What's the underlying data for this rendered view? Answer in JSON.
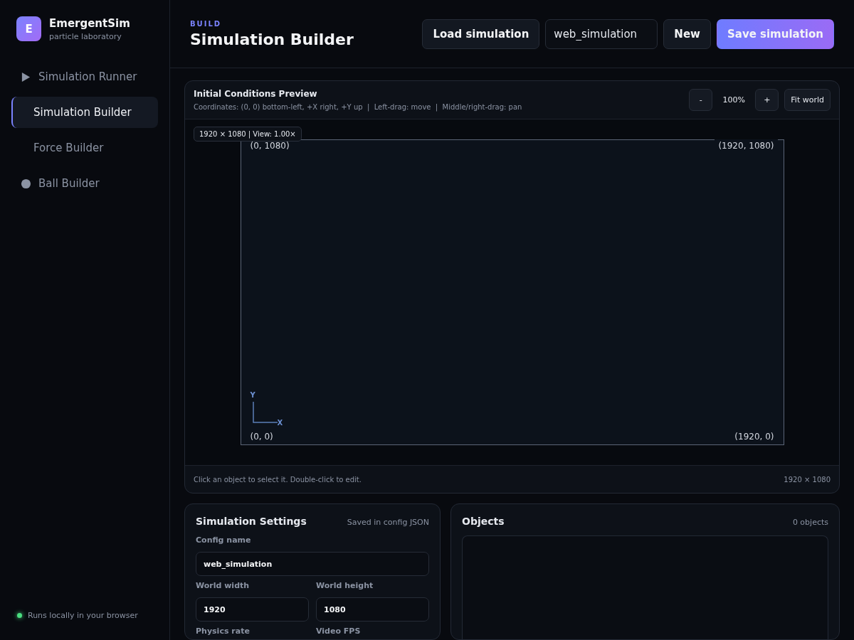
{
  "brand": {
    "initial": "E",
    "name": "EmergentSim",
    "tagline": "particle laboratory"
  },
  "nav": [
    {
      "label": "Simulation Runner",
      "kind": "play",
      "selected": false
    },
    {
      "label": "Simulation Builder",
      "kind": "plain",
      "selected": true
    },
    {
      "label": "Force Builder",
      "kind": "plain",
      "selected": false
    },
    {
      "label": "Ball Builder",
      "kind": "dot",
      "selected": false
    }
  ],
  "status": {
    "text": "Runs locally in your browser",
    "color": "#4ade80"
  },
  "header": {
    "eyebrow": "BUILD",
    "title": "Simulation Builder",
    "load_button": "Load simulation",
    "name_field": "web_simulation",
    "new_button": "New",
    "save_button": "Save simulation"
  },
  "preview": {
    "title": "Initial Conditions Preview",
    "hint": "Coordinates: (0, 0) bottom-left, +X right, +Y up  |  Left-drag: move  |  Middle/right-drag: pan",
    "zoom_out": "-",
    "zoom": "100%",
    "zoom_in": "+",
    "fit": "Fit world",
    "view_tag": "1920 × 1080 | View: 1.00×",
    "corner_top_left": "(0, 1080)",
    "corner_top_right": "(1920, 1080)",
    "corner_bottom_left": "(0, 0)",
    "corner_bottom_right": "(1920, 0)",
    "axis_y": "Y",
    "axis_x": "X",
    "footer_hint": "Click an object to select it. Double-click to edit.",
    "footer_size": "1920 × 1080"
  },
  "settings": {
    "title": "Simulation Settings",
    "note": "Saved in config JSON",
    "fields": [
      {
        "label": "Config name",
        "value": "web_simulation"
      },
      {
        "label": "World width",
        "value": "1920"
      },
      {
        "label": "World height",
        "value": "1080"
      }
    ],
    "more_labels": [
      "Physics rate",
      "Video FPS"
    ]
  },
  "objects": {
    "title": "Objects",
    "count": "0 objects"
  }
}
